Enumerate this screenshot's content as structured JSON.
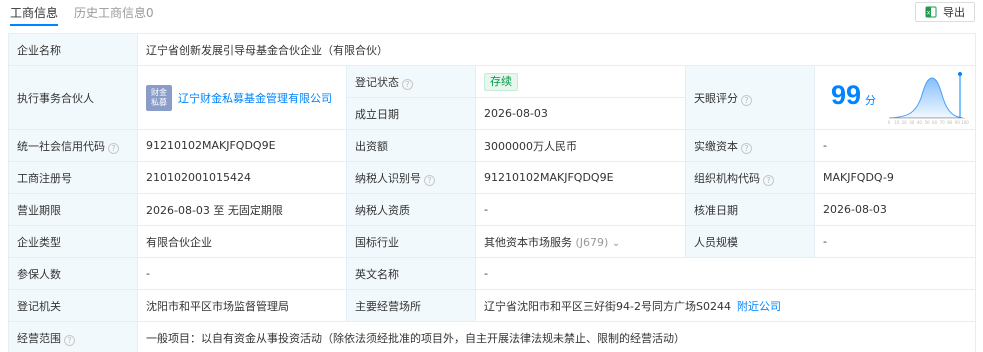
{
  "tabs": [
    {
      "label": "工商信息",
      "active": true
    },
    {
      "label": "历史工商信息0",
      "active": false
    }
  ],
  "export_label": "导出",
  "rows": {
    "company_name": {
      "label": "企业名称",
      "value": "辽宁省创新发展引导母基金合伙企业（有限合伙）"
    },
    "partner": {
      "label": "执行事务合伙人",
      "logo_text": [
        "财金",
        "私募"
      ],
      "value": "辽宁财金私募基金管理有限公司"
    },
    "reg_status": {
      "label": "登记状态",
      "value": "存续"
    },
    "established": {
      "label": "成立日期",
      "value": "2026-08-03"
    },
    "tianyan_score": {
      "label": "天眼评分",
      "value": "99",
      "unit": "分"
    },
    "credit_code": {
      "label": "统一社会信用代码",
      "value": "91210102MAKJFQDQ9E"
    },
    "capital": {
      "label": "出资额",
      "value": "3000000万人民币"
    },
    "paid_capital": {
      "label": "实缴资本",
      "value": "-"
    },
    "reg_number": {
      "label": "工商注册号",
      "value": "210102001015424"
    },
    "taxpayer_id": {
      "label": "纳税人识别号",
      "value": "91210102MAKJFQDQ9E"
    },
    "org_code": {
      "label": "组织机构代码",
      "value": "MAKJFQDQ-9"
    },
    "term": {
      "label": "营业期限",
      "value": "2026-08-03 至 无固定期限"
    },
    "taxpayer_qual": {
      "label": "纳税人资质",
      "value": "-"
    },
    "approval_date": {
      "label": "核准日期",
      "value": "2026-08-03"
    },
    "company_type": {
      "label": "企业类型",
      "value": "有限合伙企业"
    },
    "industry": {
      "label": "国标行业",
      "value": "其他资本市场服务",
      "code": "(J679)"
    },
    "staff_size": {
      "label": "人员规模",
      "value": "-"
    },
    "insured": {
      "label": "参保人数",
      "value": "-"
    },
    "english_name": {
      "label": "英文名称",
      "value": "-"
    },
    "authority": {
      "label": "登记机关",
      "value": "沈阳市和平区市场监督管理局"
    },
    "address": {
      "label": "主要经营场所",
      "value": "辽宁省沈阳市和平区三好街94-2号同方广场S0244",
      "nearby": "附近公司"
    },
    "scope": {
      "label": "经营范围",
      "value": "一般项目：以自有资金从事投资活动（除依法须经批准的项目外，自主开展法律法规未禁止、限制的经营活动）"
    }
  },
  "score_axis_ticks": [
    "0",
    "10",
    "20",
    "30",
    "40",
    "50",
    "60",
    "70",
    "80",
    "90",
    "100"
  ],
  "colors": {
    "accent": "#0084ff",
    "label_bg": "#f2f9fc",
    "border": "#e4eef6",
    "status_green": "#009944"
  }
}
